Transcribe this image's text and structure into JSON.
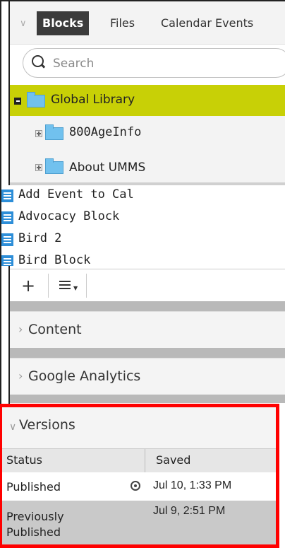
{
  "tabs": [
    {
      "label": "Blocks",
      "active": true
    },
    {
      "label": "Files"
    },
    {
      "label": "Calendar Events"
    }
  ],
  "search": {
    "placeholder": "Search",
    "value": ""
  },
  "tree": [
    {
      "label": "Global Library",
      "expanded": true,
      "selected": true
    },
    {
      "label": "800AgeInfo",
      "expanded": false
    },
    {
      "label": "About UMMS",
      "expanded": false
    }
  ],
  "blocks": [
    {
      "label": "Add Event to Cal"
    },
    {
      "label": "Advocacy Block"
    },
    {
      "label": "Bird 2"
    },
    {
      "label": "Bird Block"
    }
  ],
  "toolbar": {
    "add_label": "+",
    "menu_icon": "list-menu-icon"
  },
  "sections": [
    {
      "title": "Content",
      "collapsed": true
    },
    {
      "title": "Google Analytics",
      "collapsed": true
    }
  ],
  "versions": {
    "title": "Versions",
    "columns": [
      "Status",
      "Saved"
    ],
    "rows": [
      {
        "status": "Published",
        "saved": "Jul 10, 1:33 PM",
        "current": true
      },
      {
        "status": "Previously Published",
        "saved": "Jul 9, 2:51 PM",
        "current": false
      }
    ]
  },
  "colors": {
    "selected": "#c8d006",
    "accent_border": "#ff0000",
    "folder": "#71c1ee",
    "doc_icon": "#2d8ed8"
  }
}
